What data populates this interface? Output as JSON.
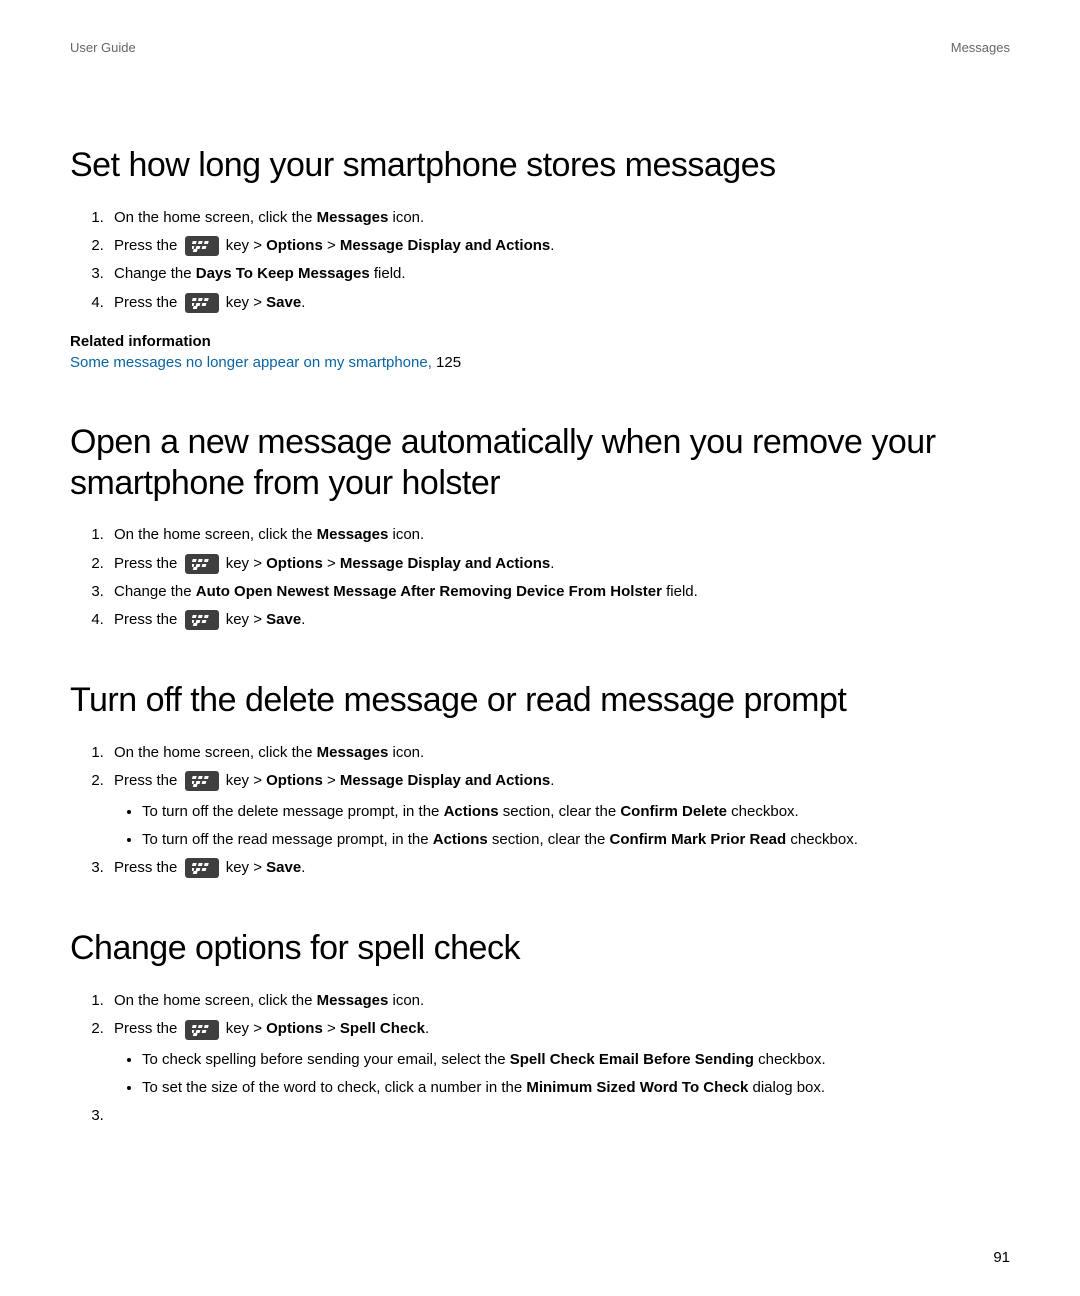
{
  "header": {
    "left": "User Guide",
    "right": "Messages"
  },
  "page_number": "91",
  "common": {
    "messages_icon_pre": "On the home screen, click the ",
    "messages_icon_bold": "Messages",
    "messages_icon_post": " icon.",
    "press_the": "Press the ",
    "key_gt": " key > ",
    "gt": " > ",
    "options": "Options",
    "save": "Save",
    "msg_display_actions": "Message Display and Actions",
    "spell_check": "Spell Check",
    "period": ".",
    "change_the": "Change the ",
    "field_period": " field."
  },
  "sec1": {
    "title": "Set how long your smartphone stores messages",
    "days_to_keep": "Days To Keep Messages",
    "related_heading": "Related information",
    "related_link": "Some messages no longer appear on my smartphone, ",
    "related_page": "125"
  },
  "sec2": {
    "title": "Open a new message automatically when you remove your smartphone from your holster",
    "auto_open": "Auto Open Newest Message After Removing Device From Holster"
  },
  "sec3": {
    "title": "Turn off the delete message or read message prompt",
    "b1_pre": "To turn off the delete message prompt, in the ",
    "actions": "Actions",
    "b1_mid": " section, clear the ",
    "confirm_delete": "Confirm Delete",
    "checkbox_period": " checkbox.",
    "b2_pre": "To turn off the read message prompt, in the ",
    "confirm_mark_prior_read": "Confirm Mark Prior Read"
  },
  "sec4": {
    "title": "Change options for spell check",
    "b1_pre": "To check spelling before sending your email, select the ",
    "spell_check_before": "Spell Check Email Before Sending",
    "b2_pre": "To set the size of the word to check, click a number in the ",
    "min_sized_word": "Minimum Sized Word To Check",
    "dialog_box_period": " dialog box."
  }
}
